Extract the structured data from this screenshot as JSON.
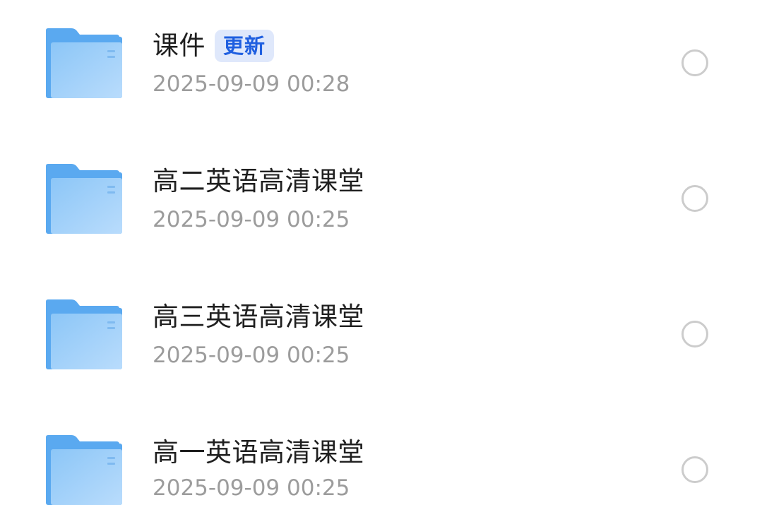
{
  "files": [
    {
      "name": "课件",
      "badge": "更新",
      "time": "2025-09-09 00:28",
      "icon": "folder-icon"
    },
    {
      "name": "高二英语高清课堂",
      "time": "2025-09-09 00:25",
      "icon": "folder-icon"
    },
    {
      "name": "高三英语高清课堂",
      "time": "2025-09-09 00:25",
      "icon": "folder-icon"
    },
    {
      "name": "高一英语高清课堂",
      "time": "2025-09-09 00:25",
      "icon": "folder-icon"
    }
  ],
  "colors": {
    "badge_text": "#1f5fe0",
    "badge_background": "#dfe8fb",
    "folder_blue": "#5aa9f0",
    "time_text": "#9c9c9c",
    "name_text": "#1f1f1f"
  }
}
